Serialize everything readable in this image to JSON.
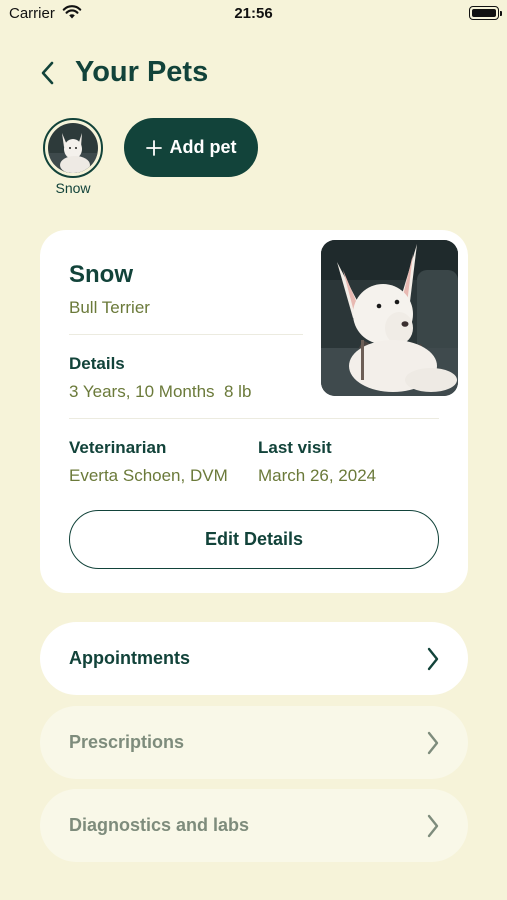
{
  "status_bar": {
    "carrier": "Carrier",
    "time": "21:56"
  },
  "header": {
    "title": "Your Pets",
    "back_icon": "chevron-left-icon"
  },
  "pets": [
    {
      "name": "Snow",
      "selected": true
    }
  ],
  "add_pet": {
    "label": "Add pet",
    "icon": "plus-icon"
  },
  "pet_card": {
    "name": "Snow",
    "breed": "Bull Terrier",
    "details_label": "Details",
    "details_value": "3 Years, 10 Months  8 lb",
    "vet_label": "Veterinarian",
    "vet_value": "Everta Schoen, DVM",
    "last_visit_label": "Last visit",
    "last_visit_value": "March 26, 2024",
    "edit_label": "Edit Details"
  },
  "menu": [
    {
      "label": "Appointments",
      "state": "active"
    },
    {
      "label": "Prescriptions",
      "state": "muted"
    },
    {
      "label": "Diagnostics and labs",
      "state": "muted"
    }
  ],
  "colors": {
    "background": "#f6f3d9",
    "primary": "#12433a",
    "secondary_text": "#6b7a3a",
    "muted_text": "#7e8c7c",
    "card": "#ffffff"
  }
}
